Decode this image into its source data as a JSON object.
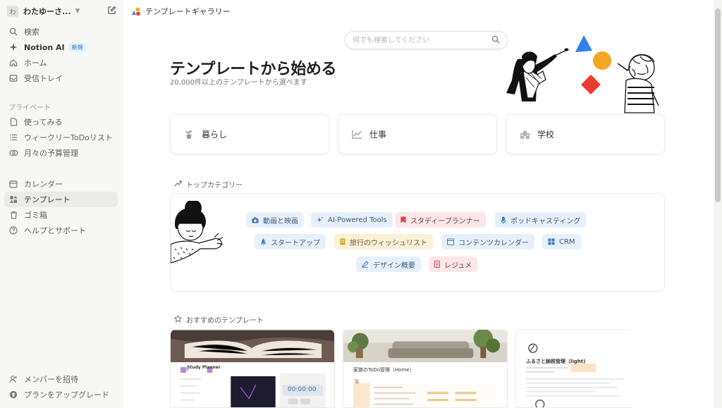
{
  "sidebar": {
    "workspace": {
      "avatar": "わ",
      "name": "わたゆーさ...",
      "chevron": "chevron-down-icon",
      "new_page_icon": "compose-icon"
    },
    "top_items": [
      {
        "label": "検索",
        "icon": "search-icon"
      },
      {
        "label": "Notion AI",
        "icon": "sparkle-icon",
        "badge": "新規"
      },
      {
        "label": "ホーム",
        "icon": "home-icon"
      },
      {
        "label": "受信トレイ",
        "icon": "inbox-icon"
      }
    ],
    "private_label": "プライベート",
    "private_items": [
      {
        "label": "使ってみる",
        "icon": "page-icon"
      },
      {
        "label": "ウィークリーToDoリスト",
        "icon": "list-icon"
      },
      {
        "label": "月々の予算管理",
        "icon": "coins-icon"
      }
    ],
    "util_items": [
      {
        "label": "カレンダー",
        "icon": "calendar-icon"
      },
      {
        "label": "テンプレート",
        "icon": "shapes-icon"
      },
      {
        "label": "ゴミ箱",
        "icon": "trash-icon"
      },
      {
        "label": "ヘルプとサポート",
        "icon": "help-icon"
      }
    ],
    "bottom_items": [
      {
        "label": "メンバーを招待",
        "icon": "add-member-icon"
      },
      {
        "label": "プランをアップグレード",
        "icon": "upgrade-icon"
      }
    ]
  },
  "topbar": {
    "breadcrumb": "テンプレートギャラリー"
  },
  "search": {
    "placeholder": "何でも検索してください"
  },
  "hero": {
    "title": "テンプレートから始める",
    "subtitle": "20,000件以上のテンプレートから選べます"
  },
  "categories": [
    {
      "label": "暮らし",
      "icon": "plant-icon"
    },
    {
      "label": "仕事",
      "icon": "chart-icon"
    },
    {
      "label": "学校",
      "icon": "school-icon"
    }
  ],
  "top_categories": {
    "heading": "トップカテゴリー",
    "chips": [
      {
        "label": "動画と映画",
        "icon": "camera-icon",
        "color": "blue"
      },
      {
        "label": "AI-Powered Tools",
        "icon": "sparkle-icon",
        "color": "blue"
      },
      {
        "label": "スタディープランナー",
        "icon": "bookmark-icon",
        "color": "pink"
      },
      {
        "label": "ポッドキャスティング",
        "icon": "mic-icon",
        "color": "blue"
      },
      {
        "label": "スタートアップ",
        "icon": "rocket-icon",
        "color": "blue"
      },
      {
        "label": "旅行のウィッシュリスト",
        "icon": "passport-icon",
        "color": "yellow"
      },
      {
        "label": "コンテンツカレンダー",
        "icon": "calendar-icon",
        "color": "blue"
      },
      {
        "label": "CRM",
        "icon": "grid-icon",
        "color": "blue"
      },
      {
        "label": "デザイン概要",
        "icon": "pen-icon",
        "color": "blue"
      },
      {
        "label": "レジュメ",
        "icon": "document-icon",
        "color": "pink"
      }
    ]
  },
  "recommended": {
    "heading": "おすすめのテンプレート",
    "cards": [
      {
        "title": "Study Planner",
        "timer": "00:00:00"
      },
      {
        "title": "家族のToDo管理（Home）"
      },
      {
        "title": "ふるさと納税管理（light)"
      }
    ]
  },
  "colors": {
    "accent_blue": "#2f80ed",
    "shape_yellow": "#f5a623",
    "shape_red": "#eb3b2f"
  }
}
